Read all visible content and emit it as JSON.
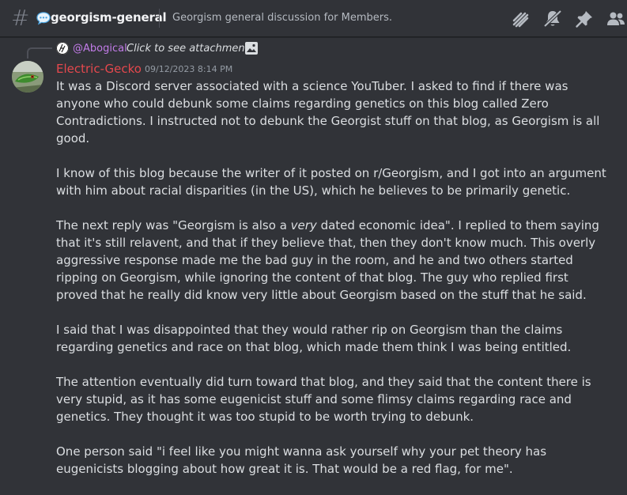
{
  "header": {
    "channel_name": "georgism-general",
    "topic": "Georgism general discussion for Members.",
    "icons": [
      "threads-icon",
      "mute-icon",
      "pin-icon",
      "members-icon"
    ]
  },
  "reply": {
    "username": "@Abogical",
    "text": "Click to see attachment",
    "attachment_icon": "image-icon"
  },
  "message": {
    "author": "Electric-Gecko",
    "timestamp": "09/12/2023 8:14 PM",
    "author_color": "#e5484d",
    "paragraphs": [
      {
        "text": "It was a Discord server associated with a science YouTuber. I asked to find if there was anyone who could debunk some claims regarding genetics on this blog called Zero Contradictions. I instructed not to debunk the Georgist stuff on that blog, as Georgism is all good."
      },
      {
        "text": "I know of this blog because the writer of it posted on r/Georgism, and I got into an argument with him about racial disparities (in the US), which he believes to be primarily genetic."
      },
      {
        "pre": "The next reply was \"Georgism is also a ",
        "em": "very",
        "post": " dated economic idea\". I replied to them saying that it's still relavent, and that if they believe that, then they don't know much. This overly aggressive response made me the bad guy in the room, and he and two others started ripping on Georgism, while ignoring the content of that blog. The guy who replied first proved that he really did know very little about Georgism based on the stuff that he said."
      },
      {
        "text": "I said that I was disappointed that they would rather rip on Georgism than the claims regarding genetics and race on that blog, which made them think I was being entitled."
      },
      {
        "text": "The attention eventually did turn toward that blog, and they said that the content there is very stupid, as it has some eugenicist stuff and some flimsy claims regarding race and genetics. They thought it was too stupid to be worth trying to debunk."
      },
      {
        "text": "One person said \"i feel like you might wanna ask yourself why your pet theory has eugenicists blogging about how great it is. That would be a red flag, for me\"."
      }
    ]
  }
}
